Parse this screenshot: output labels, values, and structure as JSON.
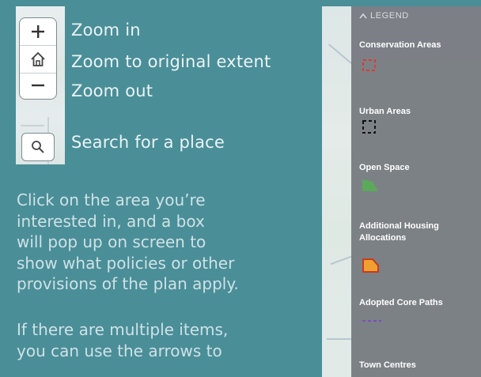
{
  "controls": {
    "zoom_in": "Zoom in",
    "zoom_home": "Zoom to original extent",
    "zoom_out": "Zoom out",
    "search": "Search for a place"
  },
  "instructions": {
    "para1": [
      "Click on the area you’re",
      "interested in, and a box",
      "will pop up on screen to",
      "show what policies or other",
      "provisions of the plan apply."
    ],
    "para2": [
      "If there are multiple items,",
      "you can use the arrows to"
    ]
  },
  "legend": {
    "title": "LEGEND",
    "items": [
      {
        "label": "Conservation Areas",
        "symbol": "dashed-red-outline",
        "color": "#e03a2f"
      },
      {
        "label": "Urban Areas",
        "symbol": "dashed-black-outline",
        "color": "#111111"
      },
      {
        "label": "Open Space",
        "symbol": "green-fill",
        "color": "#5aaa5a"
      },
      {
        "label": "Additional Housing Allocations",
        "symbol": "orange-fill-red-outline",
        "color": "#f0a030"
      },
      {
        "label": "Adopted Core Paths",
        "symbol": "dashed-purple-line",
        "color": "#7a4cc0"
      },
      {
        "label": "Town Centres",
        "symbol": "",
        "color": ""
      }
    ]
  },
  "colors": {
    "background": "#4a8e98",
    "legend_panel": "#787c82"
  }
}
